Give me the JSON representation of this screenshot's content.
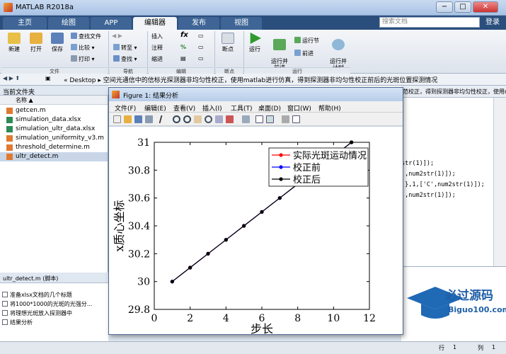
{
  "app": {
    "title": "MATLAB R2018a"
  },
  "window_buttons": {
    "min": "−",
    "max": "□",
    "close": "✕"
  },
  "tabs": [
    "主页",
    "绘图",
    "APP",
    "编辑器",
    "发布",
    "视图"
  ],
  "search": {
    "placeholder": "搜索文档"
  },
  "login_label": "登录",
  "ribbon": {
    "file": {
      "new": "新建",
      "open": "打开",
      "save": "保存",
      "find_files": "查找文件",
      "compare": "比较",
      "print": "打印",
      "group": "文件"
    },
    "nav": {
      "goto": "转至",
      "find": "查找",
      "group": "导航"
    },
    "edit": {
      "insert": "插入",
      "comment": "注释",
      "indent": "缩进",
      "fx": "fx",
      "group": "编辑"
    },
    "breakpoints": {
      "label": "断点",
      "group": "断点"
    },
    "run": {
      "run": "运行",
      "run_advance": "运行并\n前进",
      "run_section": "运行节",
      "advance": "前进",
      "run_time": "运行并\n计时",
      "group": "运行"
    }
  },
  "address": {
    "path": "« Desktop ▸ 空间光通信中的信标光探测器非均匀性校正，使用matlab进行仿真，得到探测器非均匀性校正前后的光斑位置探测情况"
  },
  "current_folder": {
    "header": "当前文件夹",
    "col_name": "名称 ▲",
    "files": [
      {
        "name": "getcen.m",
        "type": "m"
      },
      {
        "name": "simulation_data.xlsx",
        "type": "xlsx"
      },
      {
        "name": "simulation_ultr_data.xlsx",
        "type": "xlsx"
      },
      {
        "name": "simulation_uniformity_v3.m",
        "type": "m"
      },
      {
        "name": "threshold_determine.m",
        "type": "m"
      },
      {
        "name": "ultr_detect.m",
        "type": "m"
      }
    ],
    "selected_index": 5
  },
  "details": {
    "header": "ultr_detect.m  (脚本)",
    "items": [
      "准备xlsx文档的几个标题",
      "将1000*1000的光斑的光强分...",
      "将理想光斑放入探测器中",
      "结果分析"
    ]
  },
  "editor": {
    "tab_text": "范校正，得到探测器非均匀性校正，使用matlab...",
    "code": [
      "str(1)]);",
      "',num2str(1)]);",
      "'},1,['C',num2str(1)]);",
      "',num2str(1)]);"
    ]
  },
  "status": {
    "row_label": "行",
    "row": "1",
    "col_label": "列",
    "col": "1"
  },
  "watermark": {
    "line1": "必过源码",
    "line2": "Biguo100.com"
  },
  "figure": {
    "title": "Figure 1: 结果分析",
    "menu": [
      "文件(F)",
      "编辑(E)",
      "查看(V)",
      "插入(I)",
      "工具(T)",
      "桌面(D)",
      "窗口(W)",
      "帮助(H)"
    ]
  },
  "chart_data": {
    "type": "line",
    "xlabel": "步长",
    "ylabel": "x质心坐标",
    "xlim": [
      0,
      12
    ],
    "ylim": [
      29.8,
      31
    ],
    "xticks": [
      0,
      2,
      4,
      6,
      8,
      10,
      12
    ],
    "yticks": [
      29.8,
      30,
      30.2,
      30.4,
      30.6,
      30.8,
      31
    ],
    "legend_position": "top-right",
    "series": [
      {
        "name": "实际光斑运动情况",
        "color": "#ff0000",
        "x": [
          1,
          2,
          3,
          4,
          5,
          6,
          7,
          8,
          9,
          10,
          11
        ],
        "y": [
          30.0,
          30.1,
          30.2,
          30.3,
          30.4,
          30.5,
          30.6,
          30.7,
          30.8,
          30.9,
          31.0
        ]
      },
      {
        "name": "校正前",
        "color": "#0000ff",
        "x": [
          1,
          2,
          3,
          4,
          5,
          6,
          7,
          8,
          9,
          10,
          11
        ],
        "y": [
          30.0,
          30.1,
          30.2,
          30.3,
          30.4,
          30.5,
          30.6,
          30.7,
          30.8,
          30.9,
          31.0
        ]
      },
      {
        "name": "校正后",
        "color": "#000000",
        "x": [
          1,
          2,
          3,
          4,
          5,
          6,
          7,
          8,
          9,
          10,
          11
        ],
        "y": [
          30.0,
          30.1,
          30.2,
          30.3,
          30.4,
          30.5,
          30.6,
          30.7,
          30.8,
          30.9,
          31.0
        ]
      }
    ]
  }
}
